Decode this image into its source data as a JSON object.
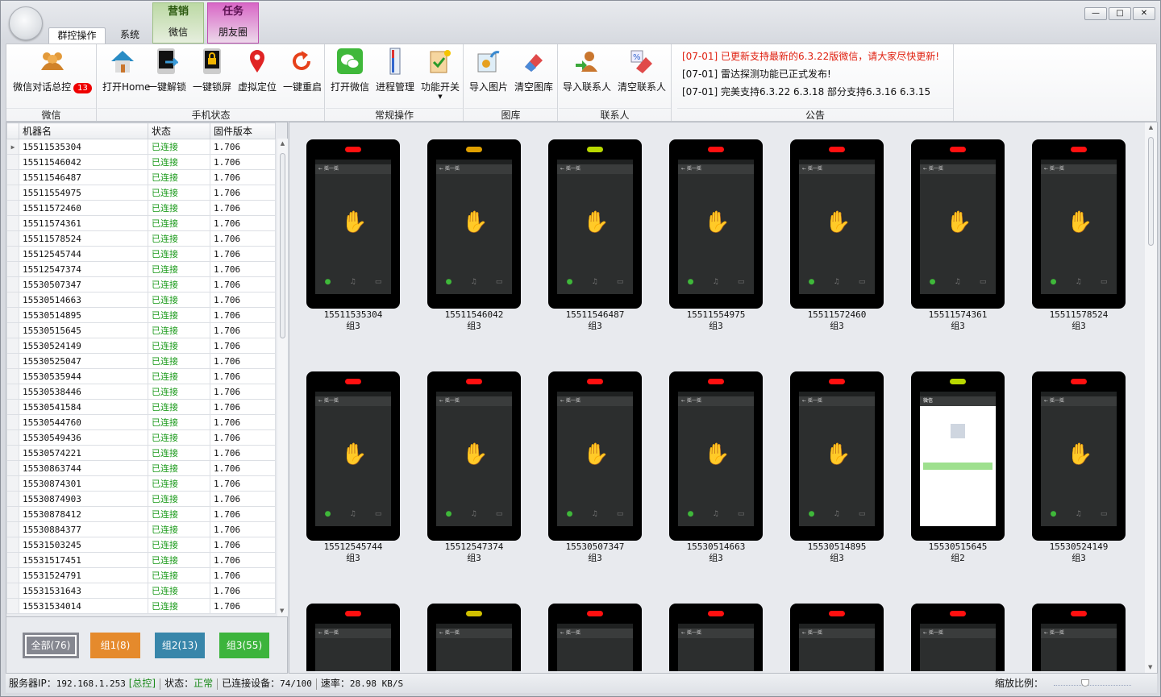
{
  "tabs": [
    {
      "label": "群控操作"
    },
    {
      "label": "系统"
    }
  ],
  "context_tabs": [
    {
      "header": "营销",
      "label": "微信",
      "color": "#bcd9a4"
    },
    {
      "header": "任务",
      "label": "朋友圈",
      "color": "#d867c6"
    }
  ],
  "window_controls": {
    "minimize": "—",
    "maximize": "□",
    "close": "✕"
  },
  "ribbon": {
    "groups": [
      {
        "label": "微信"
      },
      {
        "label": "手机状态"
      },
      {
        "label": "常规操作"
      },
      {
        "label": "图库"
      },
      {
        "label": "联系人"
      },
      {
        "label": "公告"
      }
    ],
    "buttons": {
      "chat_control": {
        "label": "微信对话总控",
        "badge": "13"
      },
      "open_home": {
        "label": "打开Home"
      },
      "unlock": {
        "label": "一键解锁"
      },
      "lock": {
        "label": "一键锁屏"
      },
      "location": {
        "label": "虚拟定位"
      },
      "reboot": {
        "label": "一键重启"
      },
      "open_wechat": {
        "label": "打开微信"
      },
      "process": {
        "label": "进程管理"
      },
      "features": {
        "label": "功能开关"
      },
      "import_img": {
        "label": "导入图片"
      },
      "clear_img": {
        "label": "清空图库"
      },
      "import_contact": {
        "label": "导入联系人"
      },
      "clear_contact": {
        "label": "清空联系人"
      }
    },
    "notices": [
      {
        "text": "[07-01] 已更新支持最新的6.3.22版微信，请大家尽快更新!",
        "color": "#e02010"
      },
      {
        "text": "[07-01] 雷达探测功能已正式发布!",
        "color": "#111111"
      },
      {
        "text": "[07-01] 完美支持6.3.22 6.3.18 部分支持6.3.16 6.3.15",
        "color": "#111111"
      }
    ]
  },
  "table": {
    "headers": [
      "机器名",
      "状态",
      "固件版本"
    ],
    "rows": [
      [
        "15511535304",
        "已连接",
        "1.706"
      ],
      [
        "15511546042",
        "已连接",
        "1.706"
      ],
      [
        "15511546487",
        "已连接",
        "1.706"
      ],
      [
        "15511554975",
        "已连接",
        "1.706"
      ],
      [
        "15511572460",
        "已连接",
        "1.706"
      ],
      [
        "15511574361",
        "已连接",
        "1.706"
      ],
      [
        "15511578524",
        "已连接",
        "1.706"
      ],
      [
        "15512545744",
        "已连接",
        "1.706"
      ],
      [
        "15512547374",
        "已连接",
        "1.706"
      ],
      [
        "15530507347",
        "已连接",
        "1.706"
      ],
      [
        "15530514663",
        "已连接",
        "1.706"
      ],
      [
        "15530514895",
        "已连接",
        "1.706"
      ],
      [
        "15530515645",
        "已连接",
        "1.706"
      ],
      [
        "15530524149",
        "已连接",
        "1.706"
      ],
      [
        "15530525047",
        "已连接",
        "1.706"
      ],
      [
        "15530535944",
        "已连接",
        "1.706"
      ],
      [
        "15530538446",
        "已连接",
        "1.706"
      ],
      [
        "15530541584",
        "已连接",
        "1.706"
      ],
      [
        "15530544760",
        "已连接",
        "1.706"
      ],
      [
        "15530549436",
        "已连接",
        "1.706"
      ],
      [
        "15530574221",
        "已连接",
        "1.706"
      ],
      [
        "15530863744",
        "已连接",
        "1.706"
      ],
      [
        "15530874301",
        "已连接",
        "1.706"
      ],
      [
        "15530874903",
        "已连接",
        "1.706"
      ],
      [
        "15530878412",
        "已连接",
        "1.706"
      ],
      [
        "15530884377",
        "已连接",
        "1.706"
      ],
      [
        "15531503245",
        "已连接",
        "1.706"
      ],
      [
        "15531517451",
        "已连接",
        "1.706"
      ],
      [
        "15531524791",
        "已连接",
        "1.706"
      ],
      [
        "15531531643",
        "已连接",
        "1.706"
      ],
      [
        "15531534014",
        "已连接",
        "1.706"
      ]
    ]
  },
  "groups": [
    {
      "label": "全部(76)",
      "color": "#858790"
    },
    {
      "label": "组1(8)",
      "color": "#e58a2c"
    },
    {
      "label": "组2(13)",
      "color": "#3886aa"
    },
    {
      "label": "组3(55)",
      "color": "#3cb43c"
    }
  ],
  "phones": [
    {
      "name": "15511535304",
      "group": "组3",
      "led": "#ff1010",
      "screen": "shake"
    },
    {
      "name": "15511546042",
      "group": "组3",
      "led": "#e0a000",
      "screen": "shake"
    },
    {
      "name": "15511546487",
      "group": "组3",
      "led": "#b8d800",
      "screen": "shake"
    },
    {
      "name": "15511554975",
      "group": "组3",
      "led": "#ff1010",
      "screen": "shake"
    },
    {
      "name": "15511572460",
      "group": "组3",
      "led": "#ff1010",
      "screen": "shake"
    },
    {
      "name": "15511574361",
      "group": "组3",
      "led": "#ff1010",
      "screen": "shake"
    },
    {
      "name": "15511578524",
      "group": "组3",
      "led": "#ff1010",
      "screen": "shake"
    },
    {
      "name": "15512545744",
      "group": "组3",
      "led": "#ff1010",
      "screen": "shake"
    },
    {
      "name": "15512547374",
      "group": "组3",
      "led": "#ff1010",
      "screen": "shake"
    },
    {
      "name": "15530507347",
      "group": "组3",
      "led": "#ff1010",
      "screen": "shake"
    },
    {
      "name": "15530514663",
      "group": "组3",
      "led": "#ff1010",
      "screen": "shake"
    },
    {
      "name": "15530514895",
      "group": "组3",
      "led": "#ff1010",
      "screen": "shake"
    },
    {
      "name": "15530515645",
      "group": "组2",
      "led": "#b8d800",
      "screen": "login"
    },
    {
      "name": "15530524149",
      "group": "组3",
      "led": "#ff1010",
      "screen": "shake"
    },
    {
      "led": "#ff1010",
      "screen": "shake"
    },
    {
      "led": "#d0c000",
      "screen": "shake"
    },
    {
      "led": "#ff1010",
      "screen": "shake"
    },
    {
      "led": "#ff1010",
      "screen": "shake"
    },
    {
      "led": "#ff1010",
      "screen": "shake"
    },
    {
      "led": "#ff1010",
      "screen": "shake"
    },
    {
      "led": "#ff1010",
      "screen": "shake"
    }
  ],
  "status": {
    "ip_label": "服务器IP：",
    "ip": "192.168.1.253",
    "role": "[总控]",
    "state_label": "状态：",
    "state": "正常",
    "devices_label": "已连接设备：",
    "devices": "74/100",
    "rate_label": "速率：",
    "rate": "28.98 KB/S",
    "zoom_label": "缩放比例：",
    "zoom_value": 0.4
  }
}
